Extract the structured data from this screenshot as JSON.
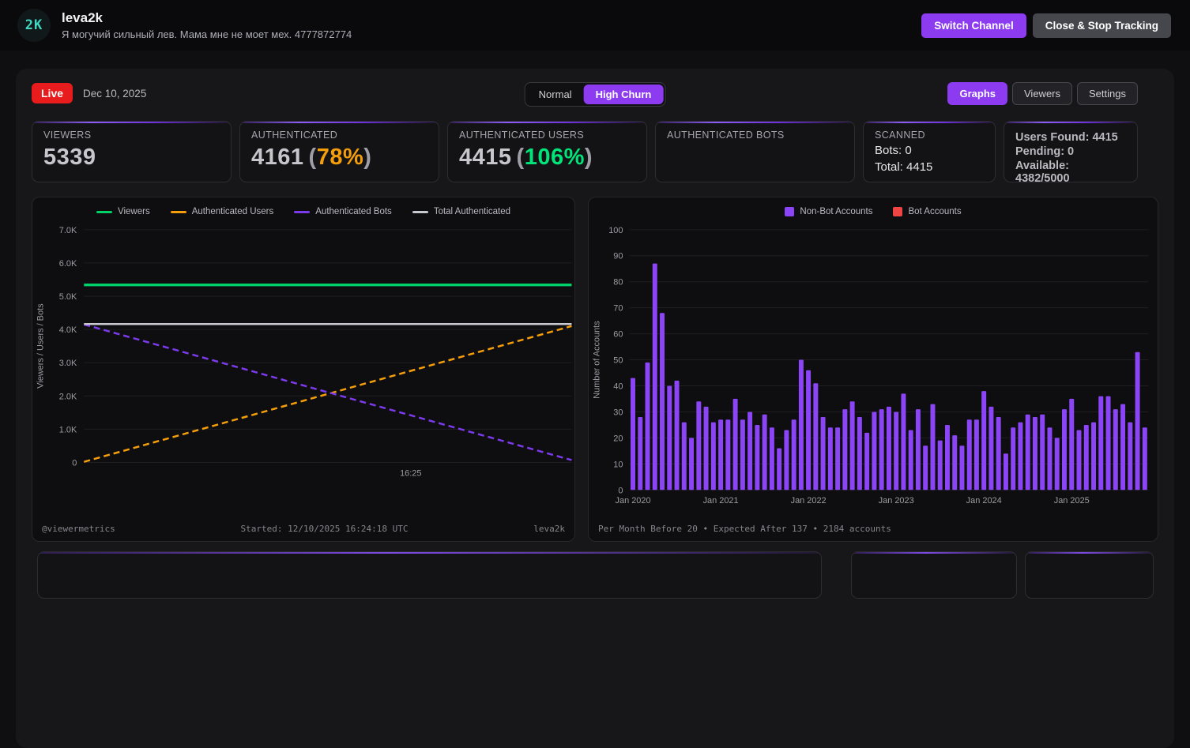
{
  "theme": {
    "accent": "#8c3bf0",
    "live": "#e81c1c"
  },
  "header": {
    "avatar_text": "2K",
    "channel_name": "leva2k",
    "channel_status": "Я могучий сильный лев. Мама мне не моет мех. 4777872774",
    "switch_channel_label": "Switch Channel",
    "close_stop_label": "Close & Stop Tracking"
  },
  "toolbar": {
    "live_label": "Live",
    "date": "Dec 10, 2025",
    "mode_normal": "Normal",
    "mode_high_churn": "High Churn",
    "tab_graphs": "Graphs",
    "tab_viewers": "Viewers",
    "tab_settings": "Settings"
  },
  "stats": {
    "viewers": {
      "label": "VIEWERS",
      "value": "5339"
    },
    "authenticated": {
      "label": "AUTHENTICATED",
      "value": "4161",
      "paren_open": "(",
      "percent": "78%",
      "paren_close": ")",
      "percent_color": "#f59e0b"
    },
    "authenticated_users": {
      "label": "AUTHENTICATED USERS",
      "value": "4415",
      "paren_open": "(",
      "percent": "106%",
      "paren_close": ")",
      "percent_color": "#00e57a"
    },
    "authenticated_bots": {
      "label": "AUTHENTICATED BOTS",
      "value": ""
    },
    "scanned": {
      "label": "SCANNED",
      "line1": "Bots: 0",
      "line2": "Total: 4415"
    },
    "quota": {
      "line1": "Users Found: 4415",
      "line2": "Pending: 0",
      "line3": "Available: 4382/5000"
    }
  },
  "chart_data": [
    {
      "type": "line",
      "ylabel": "Viewers / Users / Bots",
      "ylim": [
        0,
        7000
      ],
      "ytick_values": [
        7000,
        6000,
        5000,
        4000,
        3000,
        2000,
        1000,
        0
      ],
      "yticks": [
        "7.0K",
        "6.0K",
        "5.0K",
        "4.0K",
        "3.0K",
        "2.0K",
        "1.0K",
        "0"
      ],
      "xticks": [
        {
          "label": "16:25",
          "x": 0.67
        }
      ],
      "grid": true,
      "legend_position": "top",
      "series": [
        {
          "name": "Viewers",
          "color": "#00d26a",
          "dash": false,
          "width": 3.5,
          "points": [
            [
              0,
              5339
            ],
            [
              1,
              5339
            ]
          ]
        },
        {
          "name": "Authenticated Users",
          "color": "#f59e0b",
          "dash": true,
          "width": 2.5,
          "points": [
            [
              0,
              20
            ],
            [
              1,
              4100
            ]
          ]
        },
        {
          "name": "Authenticated Bots",
          "color": "#7c3aed",
          "dash": true,
          "width": 2.5,
          "points": [
            [
              0,
              4150
            ],
            [
              1,
              70
            ]
          ]
        },
        {
          "name": "Total Authenticated",
          "color": "#c9c9d1",
          "dash": false,
          "width": 2.5,
          "points": [
            [
              0,
              4161
            ],
            [
              1,
              4161
            ]
          ]
        }
      ],
      "footer_left": "@viewermetrics",
      "footer_center": "Started: 12/10/2025 16:24:18 UTC",
      "footer_right": "leva2k"
    },
    {
      "type": "bar",
      "ylabel": "Number of Accounts",
      "ylim": [
        0,
        100
      ],
      "ytick_step": 10,
      "grid": true,
      "legend_position": "top",
      "xticks": [
        {
          "label": "Jan 2020",
          "index": 0
        },
        {
          "label": "Jan 2021",
          "index": 12
        },
        {
          "label": "Jan 2022",
          "index": 24
        },
        {
          "label": "Jan 2023",
          "index": 36
        },
        {
          "label": "Jan 2024",
          "index": 48
        },
        {
          "label": "Jan 2025",
          "index": 60
        }
      ],
      "series": [
        {
          "name": "Non-Bot Accounts",
          "color": "#8b45f7",
          "values": [
            43,
            28,
            49,
            87,
            68,
            40,
            42,
            26,
            20,
            34,
            32,
            26,
            27,
            27,
            35,
            27,
            30,
            25,
            29,
            24,
            16,
            23,
            27,
            50,
            46,
            41,
            28,
            24,
            24,
            31,
            34,
            28,
            22,
            30,
            31,
            32,
            30,
            37,
            23,
            31,
            17,
            33,
            19,
            25,
            21,
            17,
            27,
            27,
            38,
            32,
            28,
            14,
            24,
            26,
            29,
            28,
            29,
            24,
            20,
            31,
            35,
            23,
            25,
            26,
            36,
            36,
            31,
            33,
            26,
            53,
            24
          ]
        },
        {
          "name": "Bot Accounts",
          "color": "#ef4444",
          "values": []
        }
      ],
      "footer": "Per Month Before 20 • Expected After 137 • 2184 accounts"
    }
  ]
}
